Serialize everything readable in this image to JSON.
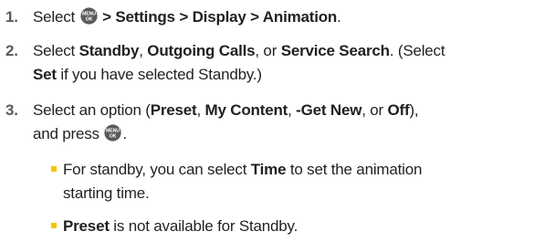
{
  "steps": [
    {
      "number": "1.",
      "lines": [
        [
          {
            "t": "Select "
          },
          {
            "icon": "menu-ok-key-icon"
          },
          {
            "t": " > Settings > Display > Animation",
            "b": true
          },
          {
            "t": "."
          }
        ]
      ]
    },
    {
      "number": "2.",
      "lines": [
        [
          {
            "t": "Select "
          },
          {
            "t": "Standby",
            "b": true
          },
          {
            "t": ", "
          },
          {
            "t": "Outgoing Calls",
            "b": true
          },
          {
            "t": ", or "
          },
          {
            "t": "Service Search",
            "b": true
          },
          {
            "t": ". (Select"
          }
        ],
        [
          {
            "t": "Set",
            "b": true
          },
          {
            "t": " if you have selected Standby.)"
          }
        ]
      ]
    },
    {
      "number": "3.",
      "lines": [
        [
          {
            "t": "Select an option ("
          },
          {
            "t": "Preset",
            "b": true
          },
          {
            "t": ", "
          },
          {
            "t": "My Content",
            "b": true
          },
          {
            "t": ", "
          },
          {
            "t": "-Get New",
            "b": true
          },
          {
            "t": ", or "
          },
          {
            "t": "Off",
            "b": true
          },
          {
            "t": "),"
          }
        ],
        [
          {
            "t": "and press "
          },
          {
            "icon": "menu-ok-key-icon"
          },
          {
            "t": "."
          }
        ]
      ]
    }
  ],
  "bullets": [
    {
      "lines": [
        [
          {
            "t": "For standby, you can select "
          },
          {
            "t": "Time",
            "b": true
          },
          {
            "t": " to set the animation"
          }
        ],
        [
          {
            "t": "starting time."
          }
        ]
      ]
    },
    {
      "lines": [
        [
          {
            "t": "Preset",
            "b": true
          },
          {
            "t": " is not available for Standby."
          }
        ]
      ]
    }
  ],
  "key_icon": {
    "top_label": "MENU",
    "bottom_label": "OK",
    "color": "#5a5a5a"
  },
  "bullet_color": "#f6c400",
  "number_color": "#5a5a5a"
}
